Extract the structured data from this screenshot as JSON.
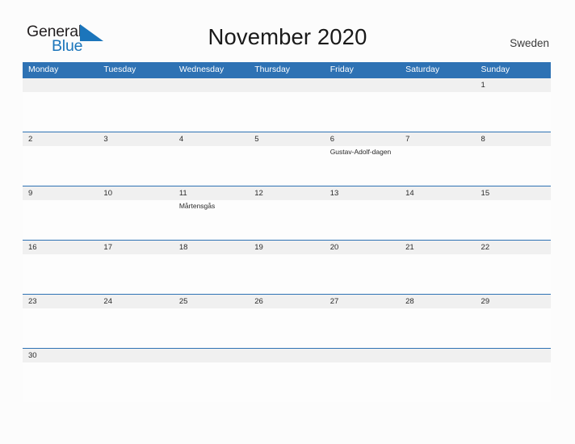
{
  "brand": {
    "name_part1": "General",
    "name_part2": "Blue",
    "flag_icon": "flag-triangle-icon",
    "color_dark": "#231f20",
    "color_blue": "#1b75bb"
  },
  "header": {
    "title": "November 2020",
    "country": "Sweden"
  },
  "theme": {
    "header_blue": "#2e72b4",
    "date_band_gray": "#f0f0f0",
    "page_background": "#fcfcfc",
    "divider_blue": "#2e72b4"
  },
  "calendar": {
    "month": "November",
    "year": "2020",
    "weekday_headers": [
      "Monday",
      "Tuesday",
      "Wednesday",
      "Thursday",
      "Friday",
      "Saturday",
      "Sunday"
    ],
    "weeks": [
      {
        "days": [
          {
            "date": "",
            "event": ""
          },
          {
            "date": "",
            "event": ""
          },
          {
            "date": "",
            "event": ""
          },
          {
            "date": "",
            "event": ""
          },
          {
            "date": "",
            "event": ""
          },
          {
            "date": "",
            "event": ""
          },
          {
            "date": "1",
            "event": ""
          }
        ]
      },
      {
        "days": [
          {
            "date": "2",
            "event": ""
          },
          {
            "date": "3",
            "event": ""
          },
          {
            "date": "4",
            "event": ""
          },
          {
            "date": "5",
            "event": ""
          },
          {
            "date": "6",
            "event": "Gustav-Adolf-dagen"
          },
          {
            "date": "7",
            "event": ""
          },
          {
            "date": "8",
            "event": ""
          }
        ]
      },
      {
        "days": [
          {
            "date": "9",
            "event": ""
          },
          {
            "date": "10",
            "event": ""
          },
          {
            "date": "11",
            "event": "Mårtensgås"
          },
          {
            "date": "12",
            "event": ""
          },
          {
            "date": "13",
            "event": ""
          },
          {
            "date": "14",
            "event": ""
          },
          {
            "date": "15",
            "event": ""
          }
        ]
      },
      {
        "days": [
          {
            "date": "16",
            "event": ""
          },
          {
            "date": "17",
            "event": ""
          },
          {
            "date": "18",
            "event": ""
          },
          {
            "date": "19",
            "event": ""
          },
          {
            "date": "20",
            "event": ""
          },
          {
            "date": "21",
            "event": ""
          },
          {
            "date": "22",
            "event": ""
          }
        ]
      },
      {
        "days": [
          {
            "date": "23",
            "event": ""
          },
          {
            "date": "24",
            "event": ""
          },
          {
            "date": "25",
            "event": ""
          },
          {
            "date": "26",
            "event": ""
          },
          {
            "date": "27",
            "event": ""
          },
          {
            "date": "28",
            "event": ""
          },
          {
            "date": "29",
            "event": ""
          }
        ]
      },
      {
        "days": [
          {
            "date": "30",
            "event": ""
          },
          {
            "date": "",
            "event": ""
          },
          {
            "date": "",
            "event": ""
          },
          {
            "date": "",
            "event": ""
          },
          {
            "date": "",
            "event": ""
          },
          {
            "date": "",
            "event": ""
          },
          {
            "date": "",
            "event": ""
          }
        ]
      }
    ]
  }
}
